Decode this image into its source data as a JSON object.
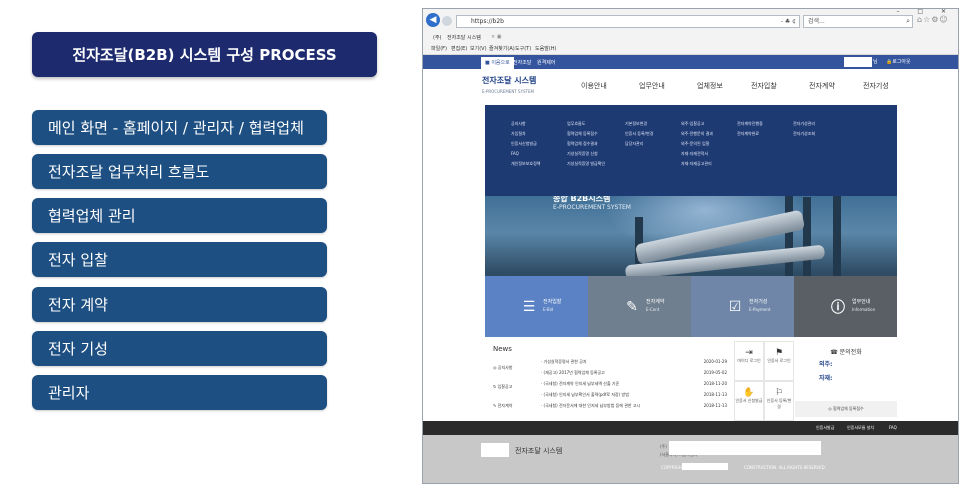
{
  "left_panel": {
    "title": "전자조달(B2B) 시스템 구성 PROCESS",
    "menu": [
      {
        "label": "메인 화면 - 홈페이지 / 관리자 / 협력업체"
      },
      {
        "label": "전자조달 업무처리 흐름도"
      },
      {
        "label": "협력업체 관리"
      },
      {
        "label": "전자 입찰"
      },
      {
        "label": "전자 계약"
      },
      {
        "label": "전자 기성"
      },
      {
        "label": "관리자"
      }
    ]
  },
  "browser": {
    "url": "https://b2b",
    "url_tools": "- ♣ ¢",
    "search_placeholder": "검색...",
    "tab_label": "전자조달 시스템",
    "tab_prefix": "(주)",
    "menubar": [
      "파일(F)",
      "편집(E)",
      "보기(V)",
      "즐겨찾기(A)",
      "도구(T)",
      "도움말(H)"
    ]
  },
  "site": {
    "topbar_tabs": [
      "■ 이음으로",
      "전자조달",
      "원격제어"
    ],
    "user_suffix": "님",
    "logout_label": "로그아웃",
    "logo": "전자조달 시스템",
    "logo_sub": "E-PROCUREMENT SYSTEM",
    "gnb": [
      "이용안내",
      "업무안내",
      "업체정보",
      "전자입찰",
      "전자계약",
      "전자기성"
    ],
    "mega_columns": [
      [
        "공지사항",
        "가입절차",
        "인증서신청발급",
        "FAQ",
        "개인정보보호정책"
      ],
      [
        "업무흐름도",
        "협력업체 등록접수",
        "협력업체 접수결과",
        "기성실적증명 신청",
        "기성실적증명 발급확인"
      ],
      [
        "기본정보변경",
        "인증서 등록/변경",
        "담당자관리"
      ],
      [
        "외주·입찰공고",
        "외주·전행문의 결과",
        "외주·문의된 입찰",
        "자재·자재견적서",
        "자재·자재공고관리"
      ],
      [
        "전자계약진행중",
        "전자계약완료"
      ],
      [
        "전자기성관리",
        "전자기성조회"
      ]
    ],
    "hero_title": "종합 B2B시스템",
    "hero_sub": "E-PROCUREMENT SYSTEM",
    "quick_links": [
      {
        "title": "전자입찰",
        "sub": "E-Bid",
        "icon": "list-icon",
        "color": "#5b82c4"
      },
      {
        "title": "전자계약",
        "sub": "E-Cont",
        "icon": "edit-icon",
        "color": "#6f7f8f"
      },
      {
        "title": "전자기성",
        "sub": "E-Payment",
        "icon": "check-icon",
        "color": "#6f86a8"
      },
      {
        "title": "업무안내",
        "sub": "Information",
        "icon": "info-icon",
        "color": "#5a5f66"
      }
    ],
    "news": {
      "heading": "News",
      "categories": [
        "공지사항",
        "입찰공고",
        "전자계약"
      ],
      "items": [
        {
          "title": "· 기성실적증명서 관한 공지",
          "date": "2020-01-29"
        },
        {
          "title": "· (재공고) 2017년 협력업체 등록공고",
          "date": "2019-05-02"
        },
        {
          "title": "· (국세청) 전자계약 인지세 납부세액 산출 기준",
          "date": "2018-11-20"
        },
        {
          "title": "· (국세청) 인지세 납부확인서 출력(pdf로 저장) 방법",
          "date": "2018-11-13"
        },
        {
          "title": "· (국세청) 전자문서에 대한 인지세 납부방법 등에 관한 고시",
          "date": "2018-11-13"
        }
      ]
    },
    "quick_grid": [
      {
        "label": "마이디 로그인",
        "icon": "login-icon"
      },
      {
        "label": "인증서 로그인",
        "icon": "cert-icon"
      },
      {
        "label": "인증서 신청발급",
        "icon": "cert-apply-icon"
      },
      {
        "label": "인증서 등록/변경",
        "icon": "cert-register-icon"
      }
    ],
    "contact": {
      "heading": "☎ 문의전화",
      "line1": "외주:",
      "line2": "자재:",
      "register_label": "◎ 협력업체 등록접수"
    },
    "bar_links": [
      "인증서발급",
      "인증서모듈 설치",
      "FAQ"
    ],
    "footer": {
      "name": "전자조달 시스템",
      "addr_label": "(주)",
      "addr2": "(서울지사) 서울특별시",
      "copyright_pre": "COPYRIGHT (C)",
      "copyright_post": "CONSTRUCTION. ALL RIGHTS RESERVED."
    }
  }
}
